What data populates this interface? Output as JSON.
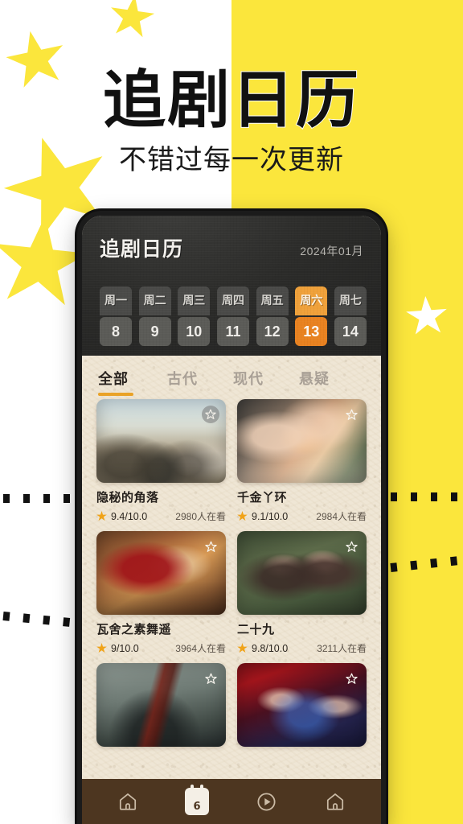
{
  "poster": {
    "headline": "追剧日历",
    "subtitle": "不错过每一次更新",
    "colors": {
      "yellow": "#FBE63C",
      "white": "#FFFFFF",
      "black": "#111111"
    }
  },
  "app": {
    "header": {
      "title": "追剧日历",
      "month": "2024年01月"
    },
    "week": [
      {
        "dow": "周一",
        "day": "8",
        "active": false
      },
      {
        "dow": "周二",
        "day": "9",
        "active": false
      },
      {
        "dow": "周三",
        "day": "10",
        "active": false
      },
      {
        "dow": "周四",
        "day": "11",
        "active": false
      },
      {
        "dow": "周五",
        "day": "12",
        "active": false
      },
      {
        "dow": "周六",
        "day": "13",
        "active": true
      },
      {
        "dow": "周七",
        "day": "14",
        "active": false
      }
    ],
    "tabs": [
      {
        "label": "全部",
        "active": true
      },
      {
        "label": "古代",
        "active": false
      },
      {
        "label": "现代",
        "active": false
      },
      {
        "label": "悬疑",
        "active": false
      }
    ],
    "shows": [
      {
        "title": "隐秘的角落",
        "rating": "9.4/10.0",
        "viewers": "2980人在看"
      },
      {
        "title": "千金丫环",
        "rating": "9.1/10.0",
        "viewers": "2984人在看"
      },
      {
        "title": "瓦舍之素舞遥",
        "rating": "9/10.0",
        "viewers": "3964人在看"
      },
      {
        "title": "二十九",
        "rating": "9.8/10.0",
        "viewers": "3211人在看"
      },
      {
        "title": "",
        "rating": "",
        "viewers": ""
      },
      {
        "title": "",
        "rating": "",
        "viewers": ""
      }
    ],
    "bottom_nav": [
      {
        "icon": "home-icon",
        "label": ""
      },
      {
        "icon": "calendar-icon",
        "label": "6"
      },
      {
        "icon": "play-icon",
        "label": ""
      },
      {
        "icon": "home-icon",
        "label": ""
      }
    ],
    "accent": "#E98220"
  }
}
